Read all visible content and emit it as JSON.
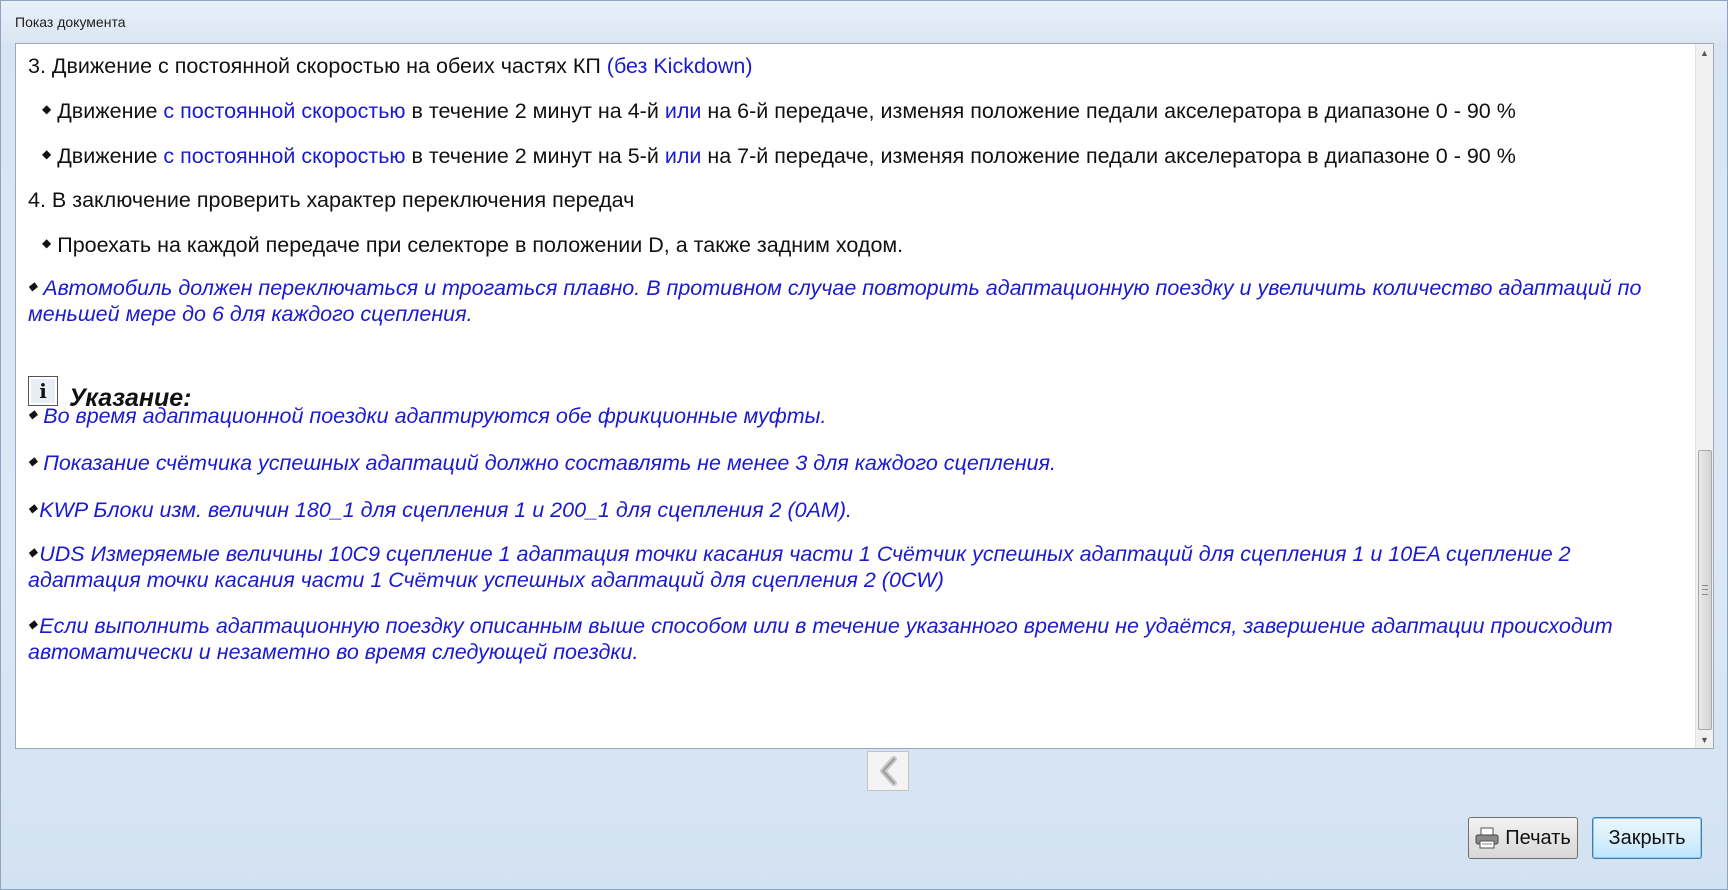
{
  "window": {
    "title": "Показ документа"
  },
  "content": {
    "step3": {
      "text": "3. Движение с постоянной скоростью на обеих частях КП ",
      "highlight": "(без Kickdown)"
    },
    "step3_items": [
      {
        "pre": "Движение ",
        "link1": "с постоянной скоростью",
        "mid": " в течение 2 минут на 4-й ",
        "link2": "или",
        "post": " на 6-й передаче, изменяя положение педали акселератора в диапазоне 0 - 90 %"
      },
      {
        "pre": "Движение ",
        "link1": "с постоянной скоростью",
        "mid": " в течение 2 минут на 5-й ",
        "link2": "или",
        "post": " на 7-й передаче, изменяя положение педали акселератора в диапазоне 0 - 90 %"
      }
    ],
    "step4": "4. В заключение проверить характер переключения передач",
    "step4_item": "Проехать на каждой передаче при селекторе в положении D, а также задним ходом.",
    "warning": "Автомобиль должен переключаться и трогаться плавно. В противном случае повторить адаптационную поездку и увеличить количество адаптаций по меньшей мере до 6 для каждого сцепления.",
    "note_title": "Указание:",
    "note_items": [
      "Во время адаптационной поездки адаптируются обе фрикционные муфты.",
      "Показание счётчика успешных адаптаций должно составлять не менее 3 для каждого сцепления.",
      "KWP Блоки изм. величин 180_1 для сцепления 1 и 200_1 для сцепления 2 (0AM).",
      "UDS Измеряемые величины 10C9 сцепление 1 адаптация точки касания части 1 Счётчик успешных адаптаций для сцепления 1 и 10EA сцепление 2 адаптация точки касания части 1 Счётчик успешных адаптаций для сцепления 2 (0CW)",
      "Если выполнить адаптационную поездку описанным выше способом или в течение указанного времени не удаётся, завершение адаптации происходит автоматически и незаметно во время следующей поездки."
    ]
  },
  "buttons": {
    "print": "Печать",
    "close": "Закрыть"
  },
  "icons": {
    "bullet": "◆",
    "info": "i",
    "back": "chevron-left-icon",
    "printer": "printer-icon"
  },
  "colors": {
    "link": "#1a1ad0",
    "text": "#111111"
  }
}
